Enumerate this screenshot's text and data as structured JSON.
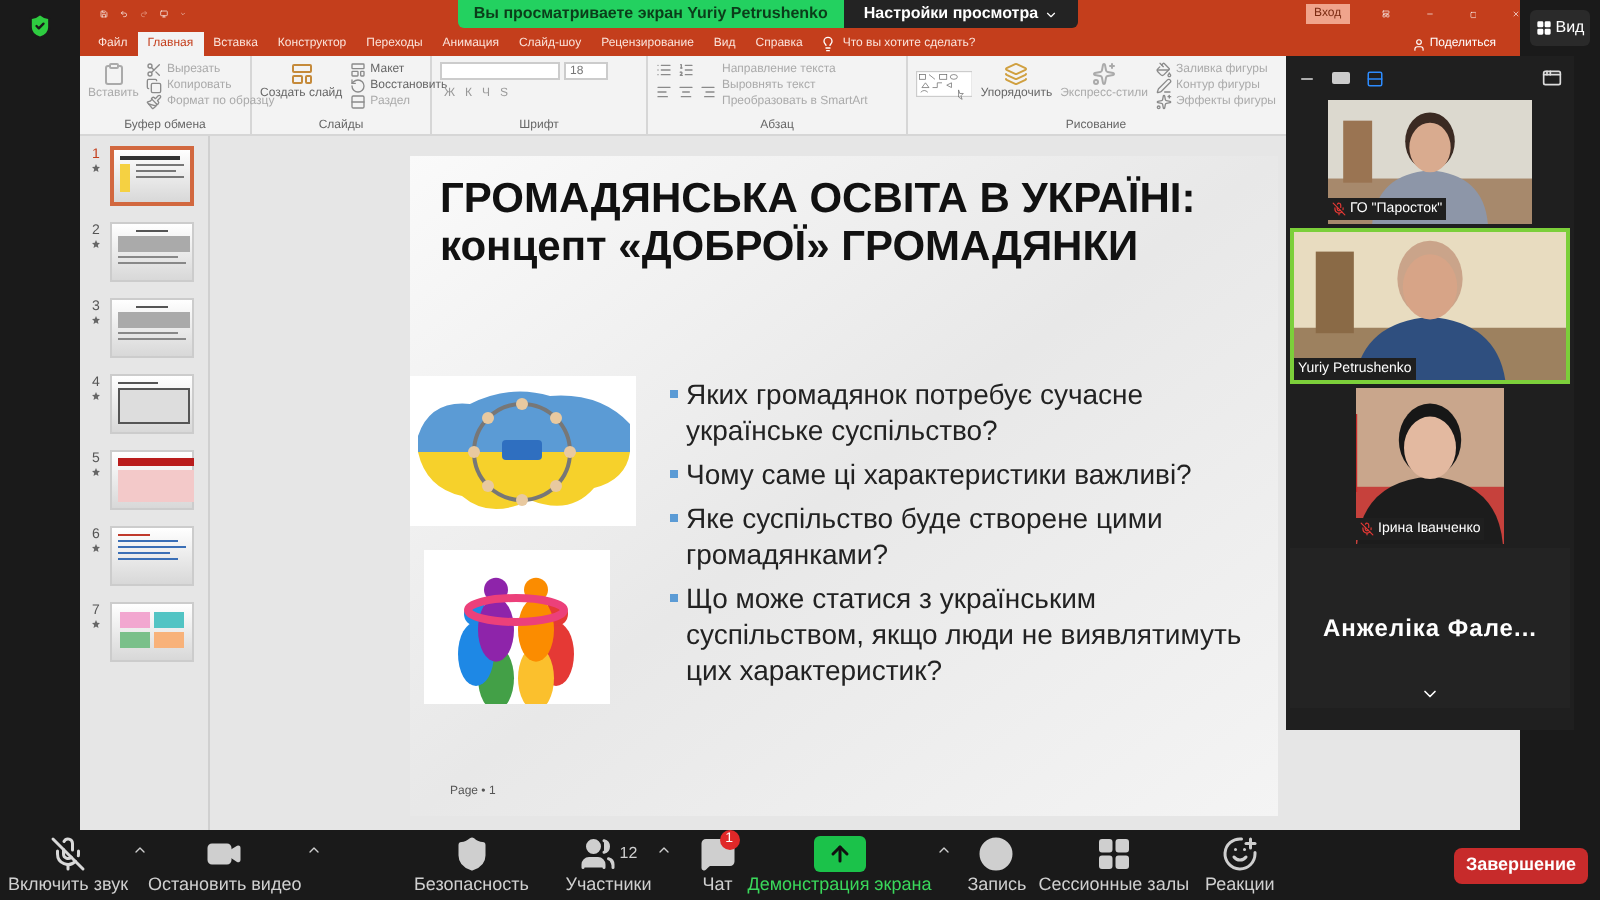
{
  "zoom_banner": {
    "text": "Вы просматриваете экран Yuriy Petrushenko",
    "view_options": "Настройки просмотра"
  },
  "powerpoint": {
    "signin": "Вход",
    "tabs": [
      {
        "label": "Файл",
        "selected": false
      },
      {
        "label": "Главная",
        "selected": true
      },
      {
        "label": "Вставка",
        "selected": false
      },
      {
        "label": "Конструктор",
        "selected": false
      },
      {
        "label": "Переходы",
        "selected": false
      },
      {
        "label": "Анимация",
        "selected": false
      },
      {
        "label": "Слайд-шоу",
        "selected": false
      },
      {
        "label": "Рецензирование",
        "selected": false
      },
      {
        "label": "Вид",
        "selected": false
      },
      {
        "label": "Справка",
        "selected": false
      }
    ],
    "search_hint": "Что вы хотите сделать?",
    "share": "Поделиться",
    "ribbon": {
      "clipboard": {
        "label": "Буфер обмена",
        "paste": "Вставить",
        "cut": "Вырезать",
        "copy": "Копировать",
        "format": "Формат по образцу"
      },
      "slides": {
        "label": "Слайды",
        "new_slide": "Создать слайд",
        "layout": "Макет",
        "reset": "Восстановить",
        "section": "Раздел"
      },
      "font": {
        "label": "Шрифт",
        "size": "18",
        "buttons": [
          "Ж",
          "К",
          "Ч",
          "S"
        ]
      },
      "paragraph": {
        "label": "Абзац",
        "direction": "Направление текста",
        "align": "Выровнять текст",
        "smartart": "Преобразовать в SmartArt"
      },
      "drawing": {
        "label": "Рисование",
        "arrange": "Упорядочить",
        "styles": "Экспресс-стили",
        "fill": "Заливка фигуры",
        "outline": "Контур фигуры",
        "effects": "Эффекты фигуры"
      }
    },
    "thumbnails": [
      {
        "number": "1",
        "selected": true,
        "kind": "title"
      },
      {
        "number": "2",
        "selected": false,
        "kind": "text"
      },
      {
        "number": "3",
        "selected": false,
        "kind": "text"
      },
      {
        "number": "4",
        "selected": false,
        "kind": "table"
      },
      {
        "number": "5",
        "selected": false,
        "kind": "red-table"
      },
      {
        "number": "6",
        "selected": false,
        "kind": "list"
      },
      {
        "number": "7",
        "selected": false,
        "kind": "boxes"
      }
    ],
    "slide": {
      "title_lines": [
        "ГРОМАДЯНСЬКА ОСВІТА В УКРАЇНІ:",
        "концепт «ДОБРОЇ» ГРОМАДЯНКИ"
      ],
      "bullets": [
        "Яких громадянок потребує сучасне українське суспільство?",
        "Чому саме ці характеристики важливі?",
        "Яке суспільство буде створене цими громадянками?",
        "Що може статися з українським суспільством, якщо люди не виявлятимуть цих характеристик?"
      ],
      "footer": "Page • 1"
    }
  },
  "video_panel": {
    "participants": [
      {
        "name": "ГО \"Паросток\"",
        "muted": true,
        "active": false,
        "kind": "video"
      },
      {
        "name": "Yuriy Petrushenko",
        "muted": false,
        "active": true,
        "kind": "video"
      },
      {
        "name": "Ірина Іванченко",
        "muted": true,
        "active": false,
        "kind": "video"
      },
      {
        "name": "Анжеліка Фале...",
        "kind": "name"
      }
    ]
  },
  "view_button": "Вид",
  "toolbar": {
    "items": [
      {
        "label": "Включить звук",
        "kind": "mic",
        "muted": true,
        "menu": true
      },
      {
        "label": "Остановить видео",
        "kind": "video",
        "menu": true
      },
      {
        "label": "Безопасность",
        "kind": "security",
        "menu": false
      },
      {
        "label": "Участники",
        "kind": "participants",
        "count": "12",
        "menu": true
      },
      {
        "label": "Чат",
        "kind": "chat",
        "badge": "1",
        "menu": false
      },
      {
        "label": "Демонстрация экрана",
        "kind": "share",
        "menu": true
      },
      {
        "label": "Запись",
        "kind": "record",
        "menu": false
      },
      {
        "label": "Сессионные залы",
        "kind": "rooms",
        "menu": false
      },
      {
        "label": "Реакции",
        "kind": "reactions",
        "menu": false
      }
    ],
    "end": "Завершение"
  }
}
